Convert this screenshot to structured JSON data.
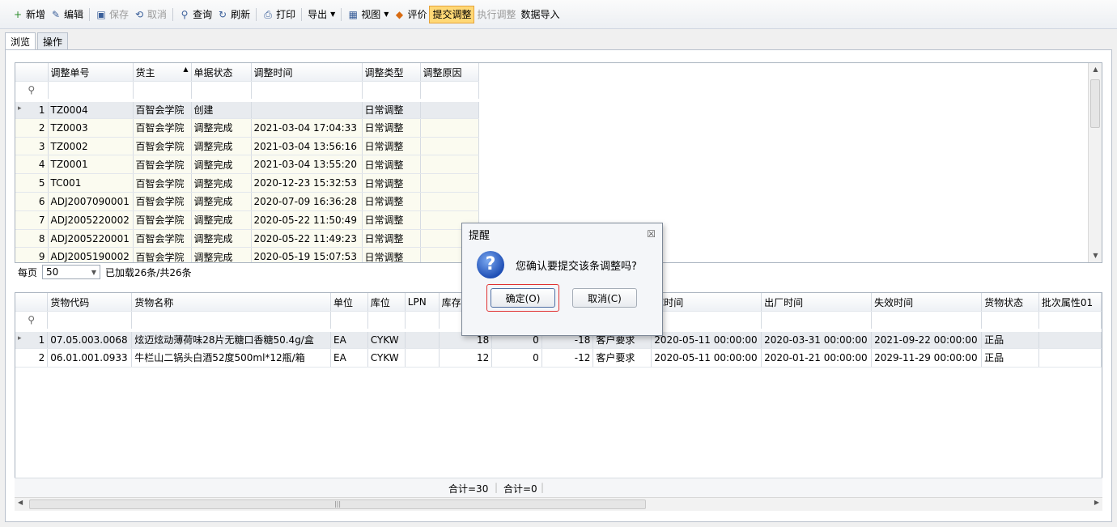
{
  "toolbar": {
    "buttons": [
      {
        "label": "新增",
        "icon": "+",
        "state": "normal"
      },
      {
        "label": "编辑",
        "icon": "✎",
        "state": "normal"
      },
      {
        "label": "保存",
        "icon": "▣",
        "state": "disabled"
      },
      {
        "label": "取消",
        "icon": "⟲",
        "state": "disabled"
      },
      {
        "label": "查询",
        "icon": "⚲",
        "state": "normal"
      },
      {
        "label": "刷新",
        "icon": "↻",
        "state": "normal"
      },
      {
        "label": "打印",
        "icon": "⎙",
        "state": "normal"
      },
      {
        "label": "导出",
        "icon": "",
        "state": "normal",
        "dropdown": true
      },
      {
        "label": "视图",
        "icon": "▦",
        "state": "normal",
        "dropdown": true
      },
      {
        "label": "评价",
        "icon": "◆",
        "state": "normal"
      },
      {
        "label": "提交调整",
        "icon": "",
        "state": "active"
      },
      {
        "label": "执行调整",
        "icon": "",
        "state": "disabled"
      },
      {
        "label": "数据导入",
        "icon": "",
        "state": "normal"
      }
    ]
  },
  "tabs": [
    {
      "label": "浏览",
      "active": true
    },
    {
      "label": "操作",
      "active": false
    }
  ],
  "master_grid": {
    "columns": [
      "调整单号",
      "货主",
      "单据状态",
      "调整时间",
      "调整类型",
      "调整原因"
    ],
    "sort_column": 1,
    "rows": [
      {
        "no": "1",
        "cells": [
          "TZ0004",
          "百智会学院",
          "创建",
          "",
          "日常调整",
          ""
        ],
        "selected": true
      },
      {
        "no": "2",
        "cells": [
          "TZ0003",
          "百智会学院",
          "调整完成",
          "2021-03-04 17:04:33",
          "日常调整",
          ""
        ]
      },
      {
        "no": "3",
        "cells": [
          "TZ0002",
          "百智会学院",
          "调整完成",
          "2021-03-04 13:56:16",
          "日常调整",
          ""
        ]
      },
      {
        "no": "4",
        "cells": [
          "TZ0001",
          "百智会学院",
          "调整完成",
          "2021-03-04 13:55:20",
          "日常调整",
          ""
        ]
      },
      {
        "no": "5",
        "cells": [
          "TC001",
          "百智会学院",
          "调整完成",
          "2020-12-23 15:32:53",
          "日常调整",
          ""
        ]
      },
      {
        "no": "6",
        "cells": [
          "ADJ2007090001",
          "百智会学院",
          "调整完成",
          "2020-07-09 16:36:28",
          "日常调整",
          ""
        ]
      },
      {
        "no": "7",
        "cells": [
          "ADJ2005220002",
          "百智会学院",
          "调整完成",
          "2020-05-22 11:50:49",
          "日常调整",
          ""
        ]
      },
      {
        "no": "8",
        "cells": [
          "ADJ2005220001",
          "百智会学院",
          "调整完成",
          "2020-05-22 11:49:23",
          "日常调整",
          ""
        ]
      },
      {
        "no": "9",
        "cells": [
          "ADJ2005190002",
          "百智会学院",
          "调整完成",
          "2020-05-19 15:07:53",
          "日常调整",
          ""
        ]
      }
    ]
  },
  "pager": {
    "per_page_label": "每页",
    "per_page_value": "50",
    "loaded_text": "已加载26条/共26条"
  },
  "detail_grid": {
    "columns": [
      "货物代码",
      "货物名称",
      "单位",
      "库位",
      "LPN",
      "库存",
      "",
      "",
      "",
      "库时间",
      "出厂时间",
      "失效时间",
      "货物状态",
      "批次属性01"
    ],
    "rows": [
      {
        "no": "1",
        "cells": [
          "07.05.003.0068",
          "炫迈炫动薄荷味28片无糖口香糖50.4g/盒",
          "EA",
          "CYKW",
          "",
          "18",
          "0",
          "-18",
          "客户要求",
          "2020-05-11 00:00:00",
          "2020-03-31 00:00:00",
          "2021-09-22 00:00:00",
          "正品",
          ""
        ],
        "selected": true
      },
      {
        "no": "2",
        "cells": [
          "06.01.001.0933",
          "牛栏山二锅头白酒52度500ml*12瓶/箱",
          "EA",
          "CYKW",
          "",
          "12",
          "0",
          "-12",
          "客户要求",
          "2020-05-11 00:00:00",
          "2020-01-21 00:00:00",
          "2029-11-29 00:00:00",
          "正品",
          ""
        ]
      }
    ],
    "footer": {
      "sum1": "合计=30",
      "sum2": "合计=0"
    }
  },
  "dialog": {
    "title": "提醒",
    "message": "您确认要提交该条调整吗?",
    "ok_label": "确定(O)",
    "cancel_label": "取消(C)",
    "close_glyph": "☒"
  },
  "colors": {
    "active_button": "#ffd876",
    "highlight_border": "#e03030",
    "question_icon": "#1f4fb5"
  }
}
